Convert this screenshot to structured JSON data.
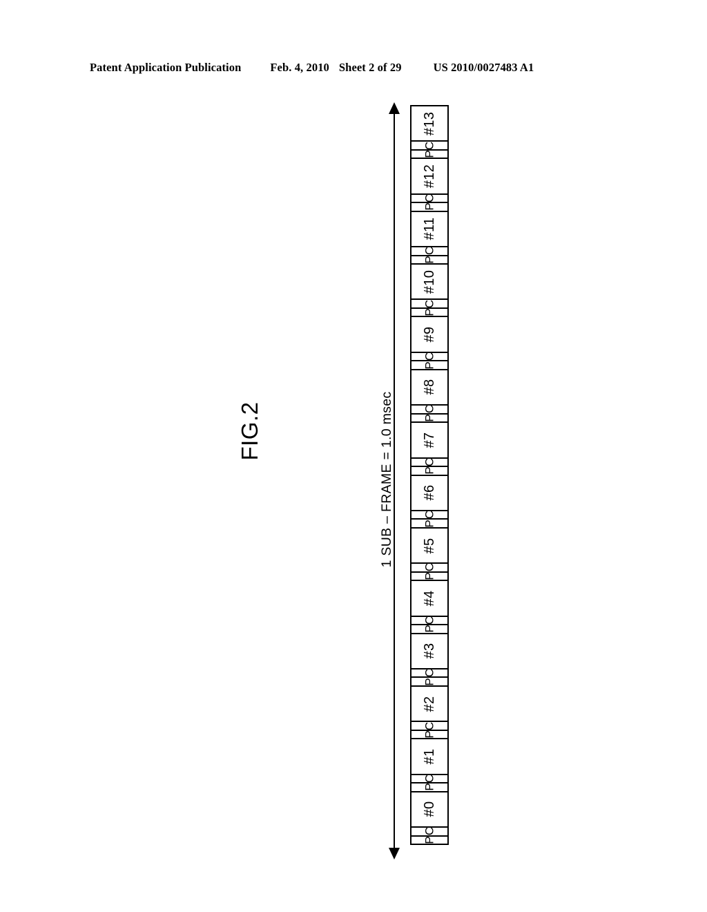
{
  "header": {
    "publication": "Patent Application Publication",
    "date": "Feb. 4, 2010",
    "sheet": "Sheet 2 of 29",
    "patent_number": "US 2010/0027483 A1"
  },
  "figure": {
    "label": "FIG.2",
    "caption": "1 SUB – FRAME = 1.0 msec",
    "arrow": {
      "name": "subframe-span-arrow",
      "direction": "double-vertical"
    },
    "slot_sublabels": {
      "c": "C",
      "p": "P"
    },
    "slots": [
      {
        "label": "#13",
        "c": "C",
        "p": "P"
      },
      {
        "label": "#12",
        "c": "C",
        "p": "P"
      },
      {
        "label": "#11",
        "c": "C",
        "p": "P"
      },
      {
        "label": "#10",
        "c": "C",
        "p": "P"
      },
      {
        "label": "#9",
        "c": "C",
        "p": "P"
      },
      {
        "label": "#8",
        "c": "C",
        "p": "P"
      },
      {
        "label": "#7",
        "c": "C",
        "p": "P"
      },
      {
        "label": "#6",
        "c": "C",
        "p": "P"
      },
      {
        "label": "#5",
        "c": "C",
        "p": "P"
      },
      {
        "label": "#4",
        "c": "C",
        "p": "P"
      },
      {
        "label": "#3",
        "c": "C",
        "p": "P"
      },
      {
        "label": "#2",
        "c": "C",
        "p": "P"
      },
      {
        "label": "#1",
        "c": "C",
        "p": "P"
      },
      {
        "label": "#0",
        "c": "C",
        "p": "P"
      }
    ]
  },
  "colors": {
    "ink": "#000000",
    "paper": "#ffffff"
  }
}
